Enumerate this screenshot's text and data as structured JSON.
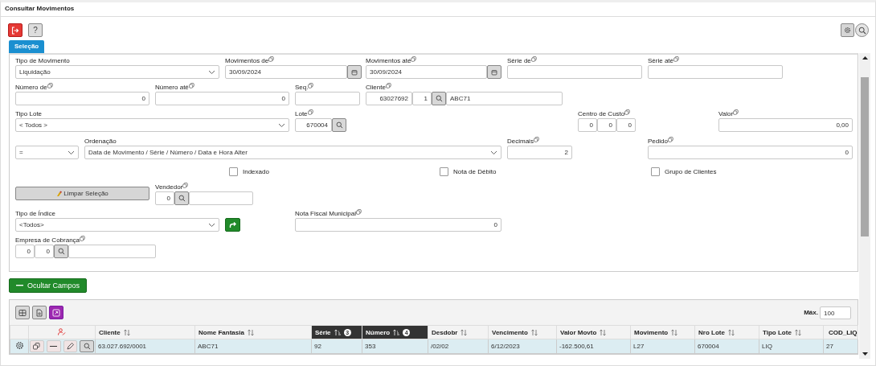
{
  "window": {
    "title": "Consultar Movimentos"
  },
  "toolbar": {
    "help_label": "?"
  },
  "tabs": [
    {
      "label": "Seleção",
      "selected": true
    }
  ],
  "form": {
    "fields": [
      {
        "kind": "select",
        "label": "Tipo de Movimento",
        "help": false,
        "value": "Liquidação"
      },
      {
        "kind": "date",
        "label": "Movimentos de",
        "help": true,
        "value": "30/09/2024"
      },
      {
        "kind": "date",
        "label": "Movimentos até",
        "help": true,
        "value": "30/09/2024"
      },
      {
        "kind": "text",
        "label": "Série de",
        "help": true
      },
      {
        "kind": "text",
        "label": "Série até",
        "help": true
      },
      {
        "kind": "number",
        "label": "Número de",
        "help": true,
        "value": "0"
      },
      {
        "kind": "number",
        "label": "Número até",
        "help": true,
        "value": "0"
      },
      {
        "kind": "text",
        "label": "Seq.",
        "help": true
      },
      {
        "kind": "lookup",
        "label": "Cliente",
        "help": true,
        "parts": [
          "63027692",
          "1"
        ],
        "description": "ABC71"
      },
      {
        "kind": "select",
        "label": "Tipo Lote",
        "help": false,
        "value": "< Todos >"
      },
      {
        "kind": "code-search",
        "label": "Lote",
        "help": true,
        "parts": [
          "670004"
        ]
      },
      {
        "kind": "multi",
        "label": "Centro de Custo",
        "help": true,
        "parts": [
          "0",
          "0",
          "0"
        ]
      },
      {
        "kind": "number",
        "label": "Valor",
        "help": true,
        "value": "0,00"
      },
      {
        "kind": "select",
        "value": "="
      },
      {
        "kind": "select",
        "label": "Ordenação",
        "help": false,
        "value": "Data de Movimento / Série / Número / Data e Hora Alter"
      },
      {
        "kind": "number",
        "label": "Decimais",
        "help": true,
        "value": "2"
      },
      {
        "kind": "number",
        "label": "Pedido",
        "help": true,
        "value": "0"
      },
      {
        "kind": "checkbox",
        "label": "Indexado",
        "checked": false
      },
      {
        "kind": "checkbox",
        "label": "Nota de Débito",
        "checked": false
      },
      {
        "kind": "checkbox",
        "label": "Grupo de Clientes",
        "checked": false
      },
      {
        "kind": "clear-button",
        "label": "Limpar Seleção"
      },
      {
        "kind": "lookup",
        "label": "Vendedor",
        "help": true,
        "parts": [
          "0"
        ]
      },
      {
        "kind": "select",
        "label": "Tipo de Índice",
        "help": false,
        "value": "<Todos>"
      },
      {
        "kind": "go-button"
      },
      {
        "kind": "number",
        "label": "Nota Fiscal Municipal",
        "help": true,
        "value": "0"
      },
      {
        "kind": "lookup",
        "label": "Empresa de Cobrança",
        "help": true,
        "parts": [
          "0",
          "0"
        ]
      }
    ]
  },
  "toggle_button": {
    "label": "Ocultar Campos"
  },
  "grid": {
    "max_label": "Máx.",
    "max_value": "100",
    "columns": [
      {
        "label": "Cliente",
        "sortable": true,
        "sorted": false
      },
      {
        "label": "Nome Fantasia",
        "sortable": true,
        "sorted": false
      },
      {
        "label": "Série",
        "sortable": true,
        "sorted": true,
        "sort_rank": "3"
      },
      {
        "label": "Número",
        "sortable": true,
        "sorted": true,
        "sort_rank": "4"
      },
      {
        "label": "Desdobr",
        "sortable": true,
        "sorted": false
      },
      {
        "label": "Vencimento",
        "sortable": true,
        "sorted": false
      },
      {
        "label": "Valor Movto",
        "sortable": true,
        "sorted": false
      },
      {
        "label": "Movimento",
        "sortable": true,
        "sorted": false
      },
      {
        "label": "Nro Lote",
        "sortable": true,
        "sorted": false
      },
      {
        "label": "Tipo Lote",
        "sortable": true,
        "sorted": false
      },
      {
        "label": "COD_LIQ",
        "sortable": false,
        "sorted": false
      }
    ],
    "rows": [
      {
        "cells": [
          "63.027.692/0001",
          "ABC71",
          "92",
          "353",
          "/02/02",
          "6/12/2023",
          "-162.500,61",
          "L27",
          "670004",
          "LIQ",
          "27"
        ]
      }
    ]
  }
}
